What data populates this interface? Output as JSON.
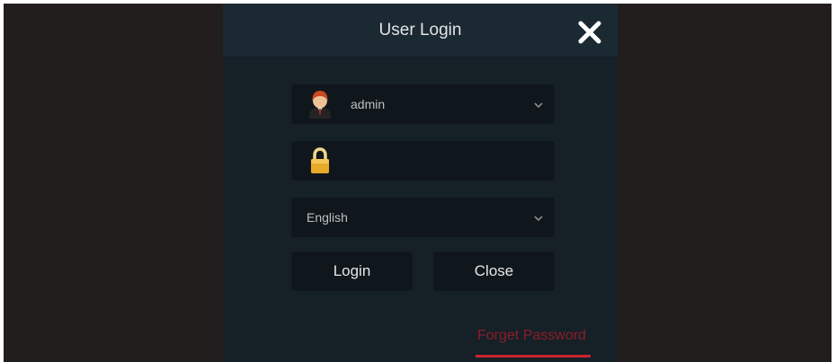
{
  "dialog": {
    "title": "User Login",
    "close_icon": "close-icon"
  },
  "form": {
    "username": {
      "value": "admin",
      "icon": "user-avatar-icon"
    },
    "password": {
      "value": "",
      "icon": "padlock-icon"
    },
    "language": {
      "value": "English"
    }
  },
  "buttons": {
    "login_label": "Login",
    "close_label": "Close"
  },
  "links": {
    "forget_password": "Forget Password"
  },
  "colors": {
    "background": "#221e1d",
    "dialog_bg": "#162027",
    "header_bg": "#1b2933",
    "field_bg": "#10171c",
    "link_color": "#8c1d27",
    "underline_color": "#c8242f"
  }
}
